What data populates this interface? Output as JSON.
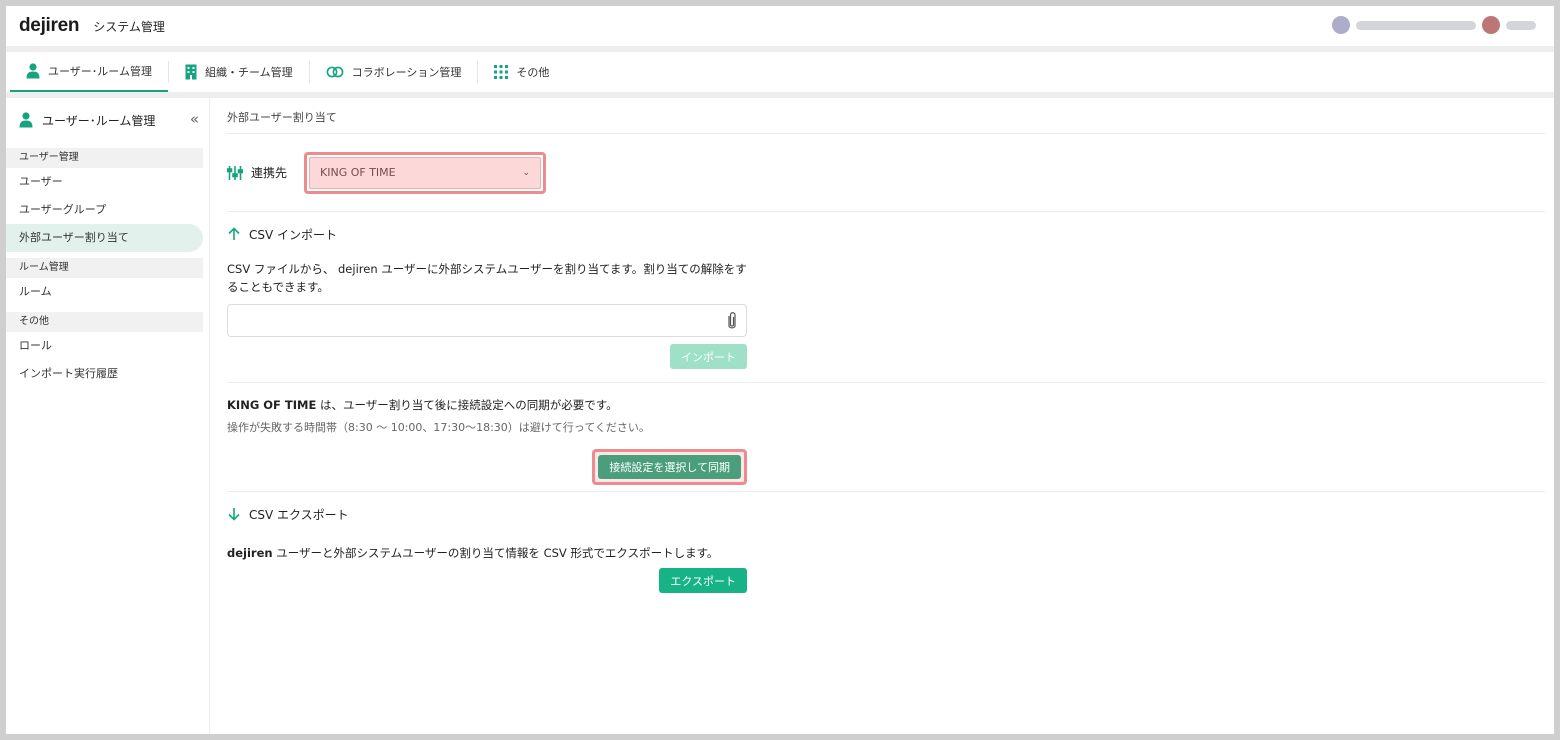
{
  "header": {
    "logo": "dejiren",
    "title": "システム管理"
  },
  "nav": {
    "tabs": [
      {
        "label": "ユーザー･ルーム管理",
        "icon": "person-icon",
        "active": true
      },
      {
        "label": "組織・チーム管理",
        "icon": "building-icon",
        "active": false
      },
      {
        "label": "コラボレーション管理",
        "icon": "link-icon",
        "active": false
      },
      {
        "label": "その他",
        "icon": "grid-icon",
        "active": false
      }
    ]
  },
  "sidebar": {
    "title": "ユーザー･ルーム管理",
    "sections": [
      {
        "label": "ユーザー管理",
        "items": [
          "ユーザー",
          "ユーザーグループ",
          "外部ユーザー割り当て"
        ]
      },
      {
        "label": "ルーム管理",
        "items": [
          "ルーム"
        ]
      },
      {
        "label": "その他",
        "items": [
          "ロール",
          "インポート実行履歴"
        ]
      }
    ],
    "active_item": "外部ユーザー割り当て"
  },
  "main": {
    "page_title": "外部ユーザー割り当て",
    "link_label": "連携先",
    "link_value": "KING OF TIME",
    "import": {
      "heading": "CSV インポート",
      "description_line1": "CSV ファイルから、 dejiren ユーザーに外部システムユーザーを割り当てます。割り当ての解除をす",
      "description_line2": "ることもできます。",
      "button": "インポート"
    },
    "sync": {
      "line_bold": "KING OF TIME",
      "line_rest": " は、ユーザー割り当て後に接続設定への同期が必要です。",
      "note": "操作が失敗する時間帯（8:30 ～ 10:00、17:30～18:30）は避けて行ってください。",
      "button": "接続設定を選択して同期"
    },
    "export": {
      "heading": "CSV エクスポート",
      "desc_bold": "dejiren",
      "desc_rest": " ユーザーと外部システムユーザーの割り当て情報を CSV 形式でエクスポートします。",
      "button": "エクスポート"
    }
  },
  "colors": {
    "accent": "#16a37f",
    "highlight": "#ec8c8f"
  }
}
